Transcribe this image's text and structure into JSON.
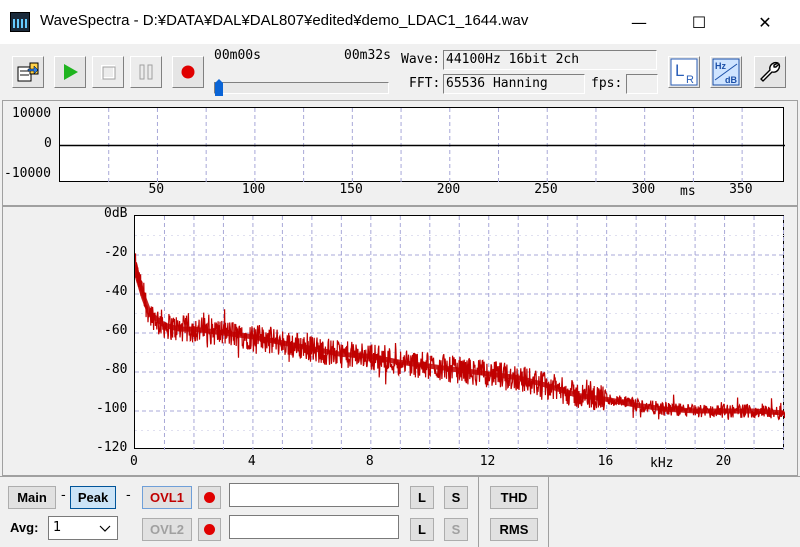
{
  "window": {
    "title": "WaveSpectra - D:¥DATA¥DAL¥DAL807¥edited¥demo_LDAC1_1644.wav",
    "minimize": "—",
    "maximize": "☐",
    "close": "✕"
  },
  "toolbar": {
    "time_start": "00m00s",
    "time_end": "00m32s",
    "wave_label": "Wave:",
    "wave_value": "44100Hz 16bit 2ch",
    "fft_label": "FFT:",
    "fft_value": "65536 Hanning",
    "fps_label": "fps:",
    "fps_value": "",
    "seek_progress": 0.0,
    "icons": [
      "open-file-icon",
      "play-icon",
      "stop-icon",
      "pause-icon",
      "record-icon",
      "lr-channel-icon",
      "hz-db-icon",
      "wrench-icon"
    ],
    "lr_button": {
      "big": "L",
      "small": "R"
    },
    "hzdb_button": {
      "hz": "Hz",
      "db": "dB"
    }
  },
  "wave_plot": {
    "y_ticks": [
      "10000",
      "0",
      "-10000"
    ],
    "x_ticks": [
      "50",
      "100",
      "150",
      "200",
      "250",
      "300",
      "350"
    ],
    "x_unit": "ms"
  },
  "chart_data": {
    "type": "line",
    "xlabel": "kHz",
    "ylabel": "",
    "y_tick_labels": [
      "0dB",
      "-20",
      "-40",
      "-60",
      "-80",
      "-100",
      "-120"
    ],
    "x_tick_labels": [
      "0",
      "4",
      "8",
      "12",
      "16",
      "20"
    ],
    "xlim": [
      0,
      22.05
    ],
    "ylim": [
      -120,
      0
    ],
    "grid": true,
    "series": [
      {
        "color": "#c00000",
        "x": [
          0,
          0.1,
          0.3,
          0.5,
          1,
          1.5,
          2,
          3,
          4,
          5,
          6,
          7,
          8,
          9,
          10,
          11,
          12,
          13,
          14,
          15,
          16,
          17,
          18,
          19,
          20,
          21,
          22
        ],
        "y": [
          -25,
          -32,
          -42,
          -50,
          -56,
          -58,
          -58,
          -60,
          -62,
          -65,
          -68,
          -71,
          -72,
          -75,
          -77,
          -79,
          -81,
          -83,
          -87,
          -92,
          -94,
          -97,
          -99,
          -100,
          -100,
          -100,
          -101
        ]
      }
    ]
  },
  "bottom": {
    "main_label": "Main",
    "dash1": "-",
    "peak_label": "Peak",
    "ovl1_label": "OVL1",
    "avg_label": "Avg:",
    "avg_value": "1",
    "dash2": "-",
    "ovl2_label": "OVL2",
    "l1": "L",
    "s1": "S",
    "l2": "L",
    "s2": "S",
    "thd_label": "THD",
    "rms_label": "RMS",
    "input1_value": "",
    "input2_value": ""
  }
}
